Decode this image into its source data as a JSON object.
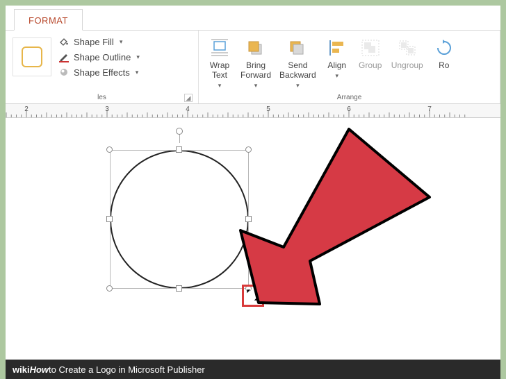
{
  "tab": {
    "format": "FORMAT"
  },
  "shape_styles": {
    "label": "les",
    "fill": "Shape Fill",
    "outline": "Shape Outline",
    "effects": "Shape Effects"
  },
  "arrange": {
    "label": "Arrange",
    "wrap_text": "Wrap\nText",
    "bring_forward": "Bring\nForward",
    "send_backward": "Send\nBackward",
    "align": "Align",
    "group": "Group",
    "ungroup": "Ungroup",
    "rotate": "Ro"
  },
  "ruler": {
    "marks": [
      "2",
      "3",
      "4",
      "5",
      "6",
      "7"
    ]
  },
  "caption": {
    "brand": "wiki",
    "how": "How",
    "text": " to Create a Logo in Microsoft Publisher"
  }
}
